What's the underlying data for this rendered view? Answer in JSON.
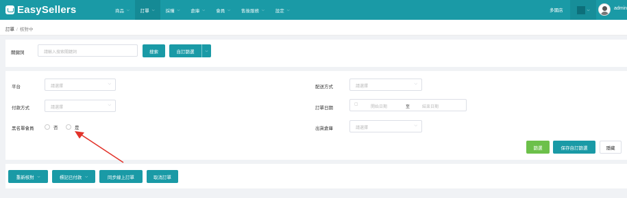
{
  "app": {
    "logo_text": "EasySellers"
  },
  "nav": {
    "items": [
      {
        "label": "商品",
        "active": false
      },
      {
        "label": "訂單",
        "active": true
      },
      {
        "label": "採購",
        "active": false
      },
      {
        "label": "倉庫",
        "active": false
      },
      {
        "label": "會員",
        "active": false
      },
      {
        "label": "售後服務",
        "active": false
      },
      {
        "label": "設定",
        "active": false
      }
    ],
    "store_label": "多國店",
    "user": "admin"
  },
  "breadcrumb": {
    "root": "訂單",
    "separator": "/",
    "current": "核對中"
  },
  "search": {
    "label": "關鍵詞",
    "placeholder": "請輸入搜索關鍵詞",
    "search_button": "搜索",
    "custom_filter_button": "自訂篩選"
  },
  "filters": {
    "platform": {
      "label": "平台",
      "placeholder": "請選擇"
    },
    "payment": {
      "label": "付款方式",
      "placeholder": "請選擇"
    },
    "blacklist": {
      "label": "黑名單會員",
      "options": [
        "否",
        "是"
      ]
    },
    "shipping": {
      "label": "配送方式",
      "placeholder": "請選擇"
    },
    "order_date": {
      "label": "訂單日期",
      "start_placeholder": "開始日期",
      "to": "至",
      "end_placeholder": "結束日期"
    },
    "warehouse": {
      "label": "出貨倉庫",
      "placeholder": "請選擇"
    },
    "filter_button": "篩選",
    "save_filter_button": "保存自訂篩選",
    "hide_button": "隱藏"
  },
  "actions": {
    "recheck": "重新核對",
    "mark_paid": "標記已付款",
    "sync_online": "同步線上訂單",
    "cancel_order": "取消訂單"
  },
  "colors": {
    "brand": "#1a9aa6",
    "green": "#6cc04a",
    "annotation_arrow": "#e2332a"
  }
}
